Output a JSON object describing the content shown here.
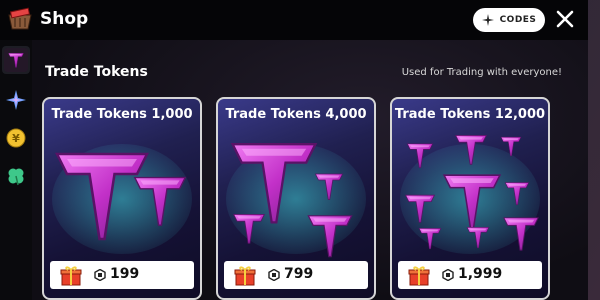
{
  "window": {
    "title": "Shop",
    "codes_label": "CODES"
  },
  "sidebar": {
    "items": [
      {
        "icon": "trade-token-icon",
        "active": true
      },
      {
        "icon": "sparkle-icon",
        "active": false
      },
      {
        "icon": "yen-coin-icon",
        "active": false
      },
      {
        "icon": "clover-icon",
        "active": false
      }
    ]
  },
  "section": {
    "title": "Trade Tokens",
    "subtitle": "Used for Trading with everyone!"
  },
  "cards": [
    {
      "title": "Trade Tokens 1,000",
      "price": "199",
      "icon": "gift-icon"
    },
    {
      "title": "Trade Tokens 4,000",
      "price": "799",
      "icon": "gift-icon"
    },
    {
      "title": "Trade Tokens 12,000",
      "price": "1,999",
      "icon": "gift-icon"
    }
  ],
  "colors": {
    "accent_pink": "#d43ad6",
    "token_dark": "#7a1c8a",
    "gift_red": "#e8402a"
  }
}
